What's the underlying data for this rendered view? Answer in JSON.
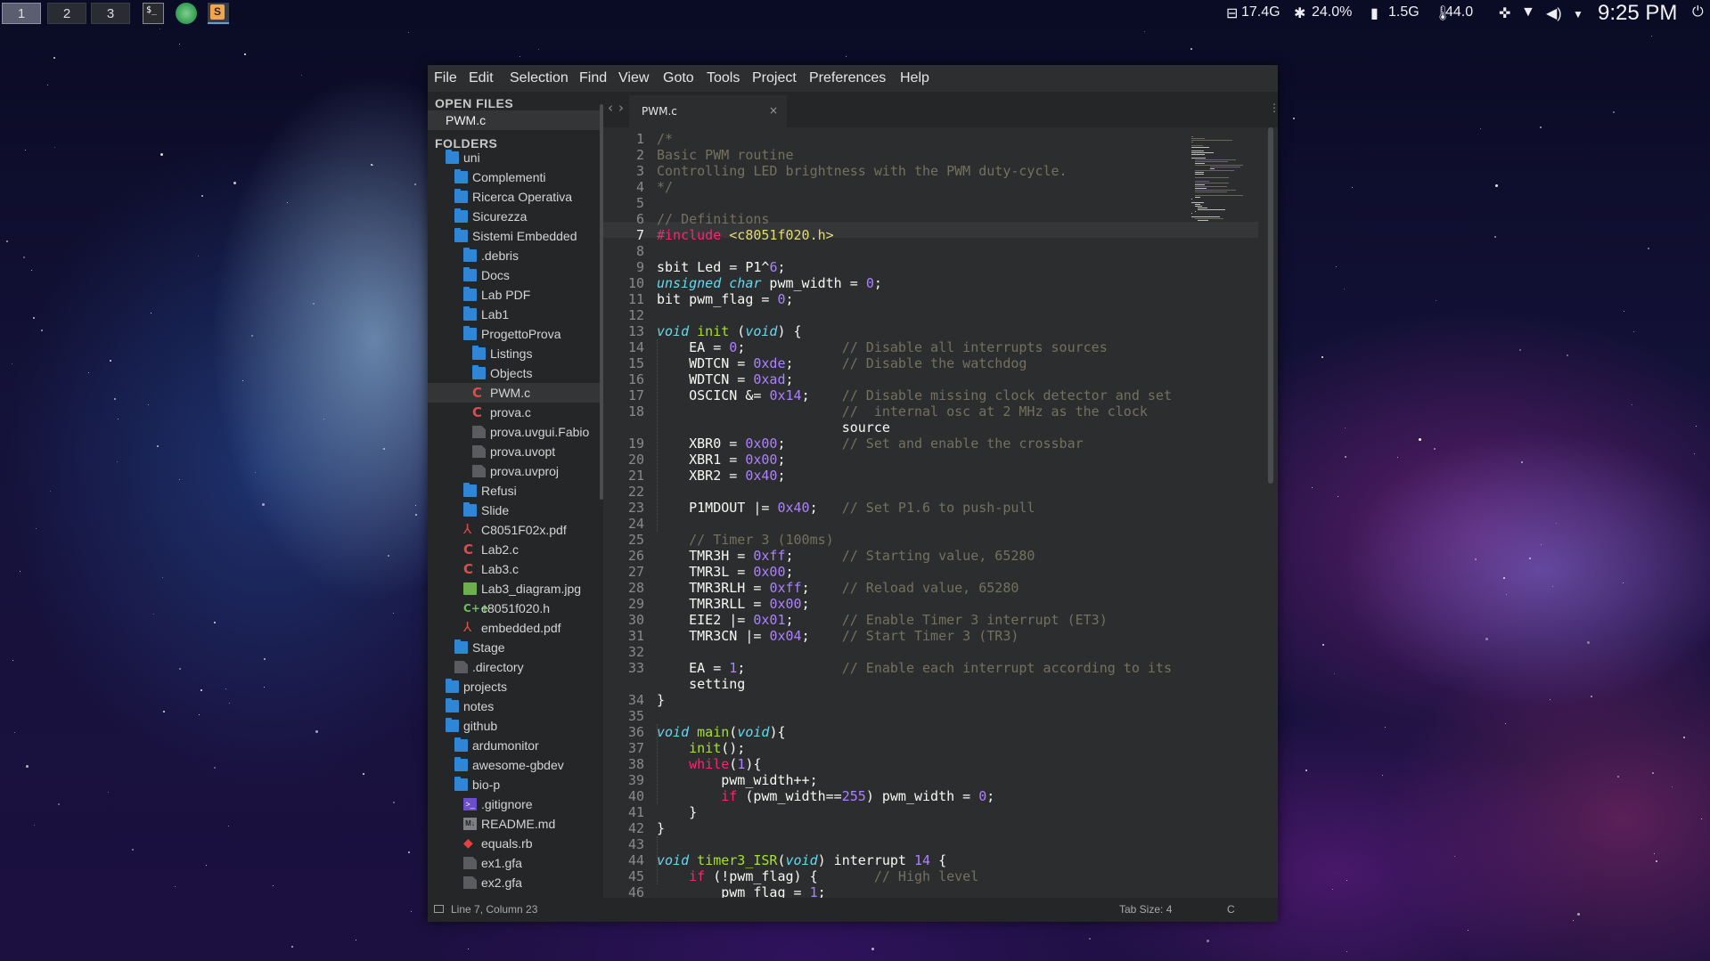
{
  "topbar": {
    "workspaces": [
      "1",
      "2",
      "3"
    ],
    "active_workspace": "1",
    "apps": [
      "terminal-app-icon",
      "chrome-app-icon",
      "sublime-app-icon"
    ],
    "disk": "17.4G",
    "cpu": "24.0%",
    "mem": "1.5G",
    "temp": "44.0",
    "clock": "9:25 PM",
    "tray_icons": [
      "dropbox-icon",
      "wifi-icon",
      "volume-icon",
      "dropdown-icon",
      "power-icon"
    ]
  },
  "editor_app": {
    "menu": [
      "File",
      "Edit",
      "Selection",
      "Find",
      "View",
      "Goto",
      "Tools",
      "Project",
      "Preferences",
      "Help"
    ],
    "sidebar": {
      "open_files_title": "OPEN FILES",
      "open_files": [
        "PWM.c"
      ],
      "folders_title": "FOLDERS",
      "tree": [
        {
          "label": "uni",
          "type": "folder-open",
          "depth": 0
        },
        {
          "label": "Complementi",
          "type": "folder",
          "depth": 1
        },
        {
          "label": "Ricerca Operativa",
          "type": "folder",
          "depth": 1
        },
        {
          "label": "Sicurezza",
          "type": "folder",
          "depth": 1
        },
        {
          "label": "Sistemi Embedded",
          "type": "folder-open",
          "depth": 1
        },
        {
          "label": ".debris",
          "type": "folder",
          "depth": 2
        },
        {
          "label": "Docs",
          "type": "folder",
          "depth": 2
        },
        {
          "label": "Lab PDF",
          "type": "folder",
          "depth": 2
        },
        {
          "label": "Lab1",
          "type": "folder",
          "depth": 2
        },
        {
          "label": "ProgettoProva",
          "type": "folder-open",
          "depth": 2
        },
        {
          "label": "Listings",
          "type": "folder",
          "depth": 3
        },
        {
          "label": "Objects",
          "type": "folder",
          "depth": 3
        },
        {
          "label": "PWM.c",
          "type": "c",
          "depth": 3,
          "selected": true
        },
        {
          "label": "prova.c",
          "type": "c",
          "depth": 3
        },
        {
          "label": "prova.uvgui.Fabio",
          "type": "file",
          "depth": 3
        },
        {
          "label": "prova.uvopt",
          "type": "file",
          "depth": 3
        },
        {
          "label": "prova.uvproj",
          "type": "file",
          "depth": 3
        },
        {
          "label": "Refusi",
          "type": "folder",
          "depth": 2
        },
        {
          "label": "Slide",
          "type": "folder",
          "depth": 2
        },
        {
          "label": "C8051F02x.pdf",
          "type": "pdf",
          "depth": 2
        },
        {
          "label": "Lab2.c",
          "type": "c",
          "depth": 2
        },
        {
          "label": "Lab3.c",
          "type": "c",
          "depth": 2
        },
        {
          "label": "Lab3_diagram.jpg",
          "type": "img",
          "depth": 2
        },
        {
          "label": "c8051f020.h",
          "type": "h",
          "depth": 2
        },
        {
          "label": "embedded.pdf",
          "type": "pdf",
          "depth": 2
        },
        {
          "label": "Stage",
          "type": "folder",
          "depth": 1
        },
        {
          "label": ".directory",
          "type": "file",
          "depth": 1
        },
        {
          "label": "projects",
          "type": "folder",
          "depth": 0
        },
        {
          "label": "notes",
          "type": "folder",
          "depth": 0
        },
        {
          "label": "github",
          "type": "folder-open",
          "depth": 0
        },
        {
          "label": "ardumonitor",
          "type": "folder",
          "depth": 1
        },
        {
          "label": "awesome-gbdev",
          "type": "folder",
          "depth": 1
        },
        {
          "label": "bio-p",
          "type": "folder-open",
          "depth": 1
        },
        {
          "label": ".gitignore",
          "type": "term",
          "depth": 2
        },
        {
          "label": "README.md",
          "type": "md",
          "depth": 2
        },
        {
          "label": "equals.rb",
          "type": "rb",
          "depth": 2
        },
        {
          "label": "ex1.gfa",
          "type": "file",
          "depth": 2
        },
        {
          "label": "ex2.gfa",
          "type": "file",
          "depth": 2
        }
      ]
    },
    "tab": {
      "label": "PWM.c",
      "close": "×"
    },
    "nav": {
      "back": "‹",
      "forward": "›",
      "more": "⋮"
    },
    "current_line": "7",
    "code": [
      {
        "n": "1",
        "t": "/*"
      },
      {
        "n": "2",
        "t": "Basic PWM routine"
      },
      {
        "n": "3",
        "t": "Controlling LED brightness with the PWM duty-cycle."
      },
      {
        "n": "4",
        "t": "*/"
      },
      {
        "n": "5",
        "t": ""
      },
      {
        "n": "6",
        "t": "// Definitions"
      },
      {
        "n": "7",
        "t": "#include <c8051f020.h>"
      },
      {
        "n": "8",
        "t": ""
      },
      {
        "n": "9",
        "t": "sbit Led = P1^6;"
      },
      {
        "n": "10",
        "t": "unsigned char pwm_width = 0;"
      },
      {
        "n": "11",
        "t": "bit pwm_flag = 0;"
      },
      {
        "n": "12",
        "t": ""
      },
      {
        "n": "13",
        "t": "void init (void) {"
      },
      {
        "n": "14",
        "t": "    EA = 0;            // Disable all interrupts sources"
      },
      {
        "n": "15",
        "t": "    WDTCN = 0xde;      // Disable the watchdog"
      },
      {
        "n": "16",
        "t": "    WDTCN = 0xad;"
      },
      {
        "n": "17",
        "t": "    OSCICN &= 0x14;    // Disable missing clock detector and set"
      },
      {
        "n": "18",
        "t": "                       //  internal osc at 2 MHz as the clock"
      },
      {
        "n": "",
        "t": "                       source"
      },
      {
        "n": "19",
        "t": "    XBR0 = 0x00;       // Set and enable the crossbar"
      },
      {
        "n": "20",
        "t": "    XBR1 = 0x00;"
      },
      {
        "n": "21",
        "t": "    XBR2 = 0x40;"
      },
      {
        "n": "22",
        "t": ""
      },
      {
        "n": "23",
        "t": "    P1MDOUT |= 0x40;   // Set P1.6 to push-pull"
      },
      {
        "n": "24",
        "t": ""
      },
      {
        "n": "25",
        "t": "    // Timer 3 (100ms)"
      },
      {
        "n": "26",
        "t": "    TMR3H = 0xff;      // Starting value, 65280"
      },
      {
        "n": "27",
        "t": "    TMR3L = 0x00;"
      },
      {
        "n": "28",
        "t": "    TMR3RLH = 0xff;    // Reload value, 65280"
      },
      {
        "n": "29",
        "t": "    TMR3RLL = 0x00;"
      },
      {
        "n": "30",
        "t": "    EIE2 |= 0x01;      // Enable Timer 3 interrupt (ET3)"
      },
      {
        "n": "31",
        "t": "    TMR3CN |= 0x04;    // Start Timer 3 (TR3)"
      },
      {
        "n": "32",
        "t": ""
      },
      {
        "n": "33",
        "t": "    EA = 1;            // Enable each interrupt according to its"
      },
      {
        "n": "",
        "t": "    setting"
      },
      {
        "n": "34",
        "t": "}"
      },
      {
        "n": "35",
        "t": ""
      },
      {
        "n": "36",
        "t": "void main(void){"
      },
      {
        "n": "37",
        "t": "    init();"
      },
      {
        "n": "38",
        "t": "    while(1){"
      },
      {
        "n": "39",
        "t": "        pwm_width++;"
      },
      {
        "n": "40",
        "t": "        if (pwm_width==255) pwm_width = 0;"
      },
      {
        "n": "41",
        "t": "    }"
      },
      {
        "n": "42",
        "t": "}"
      },
      {
        "n": "43",
        "t": ""
      },
      {
        "n": "44",
        "t": "void timer3_ISR(void) interrupt 14 {"
      },
      {
        "n": "45",
        "t": "    if (!pwm_flag) {       // High level"
      },
      {
        "n": "46",
        "t": "        pwm_flag = 1;"
      }
    ],
    "status": {
      "position": "Line 7, Column 23",
      "tab_size": "Tab Size: 4",
      "syntax": "C"
    }
  }
}
